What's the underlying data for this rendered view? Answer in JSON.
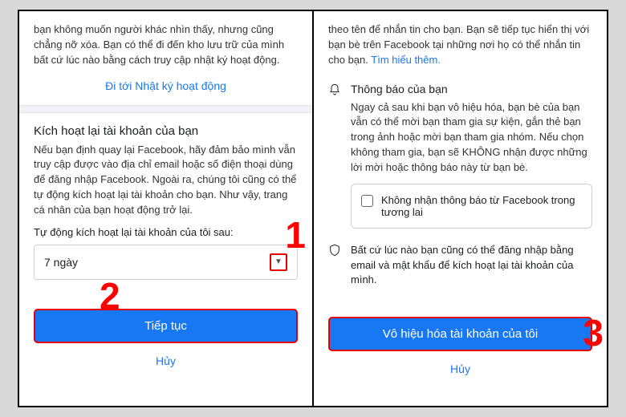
{
  "left": {
    "intro_text": "bạn không muốn người khác nhìn thấy, nhưng cũng chẳng nỡ xóa. Bạn có thể đi đến kho lưu trữ của mình bất cứ lúc nào bằng cách truy cập nhật ký hoạt động.",
    "activity_log_link": "Đi tới Nhật ký hoạt động",
    "reactivate_title": "Kích hoạt lại tài khoản của bạn",
    "reactivate_body": "Nếu bạn định quay lại Facebook, hãy đảm bảo mình vẫn truy cập được vào địa chỉ email hoặc số điện thoại dùng để đăng nhập Facebook. Ngoài ra, chúng tôi cũng có thể tự động kích hoạt lại tài khoản cho bạn. Như vậy, trang cá nhân của bạn hoạt động trở lại.",
    "auto_label": "Tự động kích hoạt lại tài khoản của tôi sau:",
    "select_value": "7 ngày",
    "continue_btn": "Tiếp tục",
    "cancel": "Hủy"
  },
  "right": {
    "intro_text": "theo tên để nhắn tin cho bạn. Bạn sẽ tiếp tục hiển thị với bạn bè trên Facebook tại những nơi họ có thể nhắn tin cho bạn. ",
    "learn_more": "Tìm hiểu thêm.",
    "notif_title": "Thông báo của bạn",
    "notif_body": "Ngay cả sau khi bạn vô hiệu hóa, bạn bè của bạn vẫn có thể mời bạn tham gia sự kiện, gắn thẻ bạn trong ảnh hoặc mời bạn tham gia nhóm. Nếu chọn không tham gia, bạn sẽ KHÔNG nhận được những lời mời hoặc thông báo này từ bạn bè.",
    "checkbox_label": "Không nhận thông báo từ Facebook trong tương lai",
    "shield_text": "Bất cứ lúc nào bạn cũng có thể đăng nhập bằng email và mật khẩu để kích hoạt lại tài khoản của mình.",
    "deactivate_btn": "Vô hiệu hóa tài khoản của tôi",
    "cancel": "Hủy"
  },
  "annotations": {
    "a1": "1",
    "a2": "2",
    "a3": "3"
  }
}
